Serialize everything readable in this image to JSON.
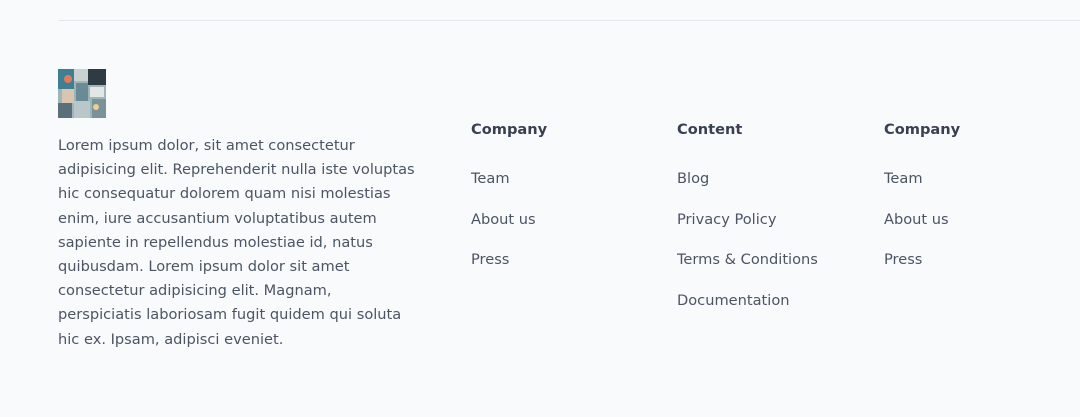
{
  "footer": {
    "logo": {
      "icon": "logo-image"
    },
    "about_text": "Lorem ipsum dolor, sit amet consectetur adipisicing elit. Reprehenderit nulla iste voluptas hic consequatur dolorem quam nisi molestias enim, iure accusantium voluptatibus autem sapiente in repellendus molestiae id, natus quibusdam. Lorem ipsum dolor sit amet consectetur adipisicing elit. Magnam, perspiciatis laboriosam fugit quidem qui soluta hic ex. Ipsam, adipisci eveniet.",
    "columns": [
      {
        "title": "Company",
        "links": [
          "Team",
          "About us",
          "Press"
        ]
      },
      {
        "title": "Content",
        "links": [
          "Blog",
          "Privacy Policy",
          "Terms & Conditions",
          "Documentation"
        ]
      },
      {
        "title": "Company",
        "links": [
          "Team",
          "About us",
          "Press"
        ]
      }
    ]
  },
  "colors": {
    "background": "#f9fafb",
    "text": "#4b5563",
    "heading": "#374151",
    "divider": "#e5e7eb"
  }
}
